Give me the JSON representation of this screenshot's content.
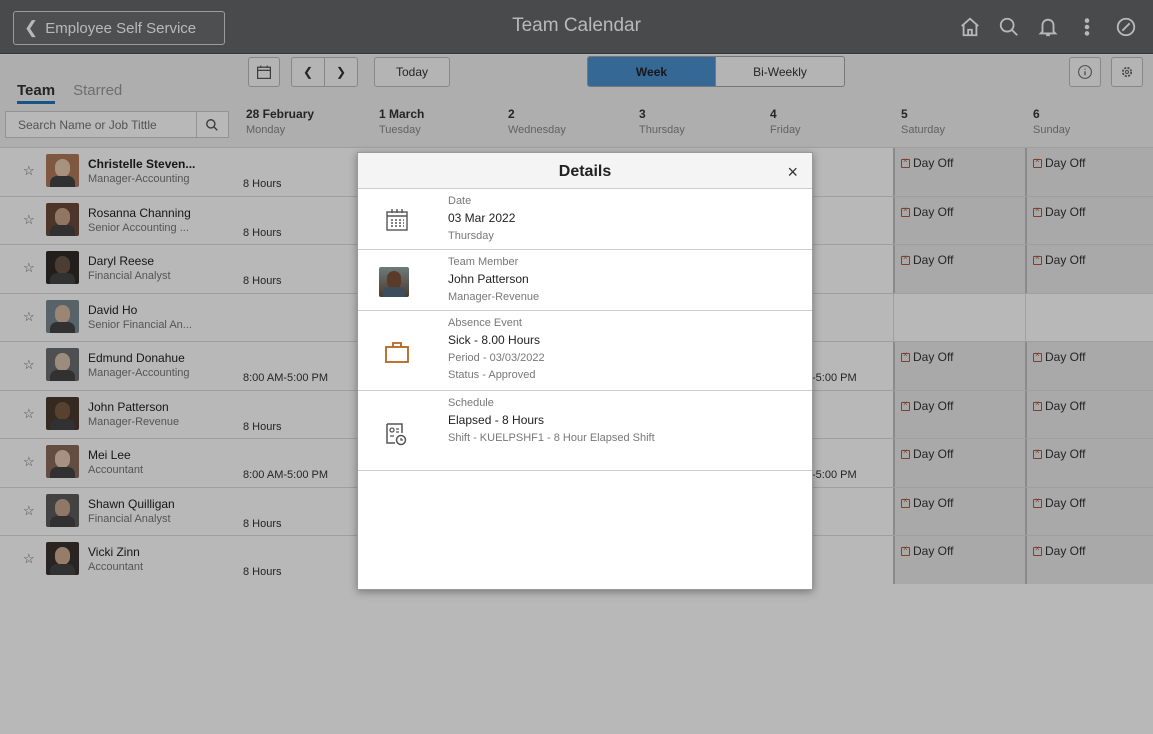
{
  "topbar": {
    "back_label": "Employee Self Service",
    "title": "Team Calendar",
    "icons": [
      "home-icon",
      "search-icon",
      "bell-icon",
      "more-icon",
      "navbar-icon"
    ]
  },
  "left_panel": {
    "tab_team": "Team",
    "tab_starred": "Starred",
    "search_placeholder": "Search Name or Job Tittle"
  },
  "toolbar": {
    "today": "Today",
    "week": "Week",
    "biweekly": "Bi-Weekly"
  },
  "days": [
    {
      "date": "28 February",
      "weekday": "Monday"
    },
    {
      "date": "1 March",
      "weekday": "Tuesday"
    },
    {
      "date": "2",
      "weekday": "Wednesday"
    },
    {
      "date": "3",
      "weekday": "Thursday"
    },
    {
      "date": "4",
      "weekday": "Friday"
    },
    {
      "date": "5",
      "weekday": "Saturday"
    },
    {
      "date": "6",
      "weekday": "Sunday"
    }
  ],
  "employees": [
    {
      "name": "Christelle Steven...",
      "job": "Manager-Accounting",
      "mon": "8 Hours",
      "fri": "",
      "sat": "Day Off",
      "sun": "Day Off"
    },
    {
      "name": "Rosanna Channing",
      "job": "Senior Accounting ...",
      "mon": "8 Hours",
      "fri": "",
      "sat": "Day Off",
      "sun": "Day Off"
    },
    {
      "name": "Daryl Reese",
      "job": "Financial Analyst",
      "mon": "8 Hours",
      "fri": "",
      "sat": "Day Off",
      "sun": "Day Off"
    },
    {
      "name": "David Ho",
      "job": "Senior Financial An...",
      "mon": "",
      "fri": "",
      "sat": "",
      "sun": ""
    },
    {
      "name": "Edmund Donahue",
      "job": "Manager-Accounting",
      "mon": "8:00 AM-5:00 PM",
      "fri": "-5:00 PM",
      "sat": "Day Off",
      "sun": "Day Off"
    },
    {
      "name": "John Patterson",
      "job": "Manager-Revenue",
      "mon": "8 Hours",
      "fri": "",
      "sat": "Day Off",
      "sun": "Day Off"
    },
    {
      "name": "Mei Lee",
      "job": "Accountant",
      "mon": "8:00 AM-5:00 PM",
      "fri": "-5:00 PM",
      "sat": "Day Off",
      "sun": "Day Off"
    },
    {
      "name": "Shawn Quilligan",
      "job": "Financial Analyst",
      "mon": "8 Hours",
      "fri": "",
      "sat": "Day Off",
      "sun": "Day Off"
    },
    {
      "name": "Vicki Zinn",
      "job": "Accountant",
      "mon": "8 Hours",
      "fri": "",
      "sat": "Day Off",
      "sun": "Day Off"
    }
  ],
  "modal": {
    "title": "Details",
    "close": "×",
    "date": {
      "label": "Date",
      "value": "03 Mar 2022",
      "sub": "Thursday"
    },
    "member": {
      "label": "Team Member",
      "value": "John Patterson",
      "sub": "Manager-Revenue"
    },
    "absence": {
      "label": "Absence Event",
      "value": "Sick - 8.00 Hours",
      "period": "Period - 03/03/2022",
      "status": "Status - Approved"
    },
    "schedule": {
      "label": "Schedule",
      "value": "Elapsed - 8 Hours",
      "shift": "Shift - KUELPSHF1 - 8 Hour Elapsed Shift"
    }
  },
  "colors": {
    "topbar": "#666769",
    "accent": "#4c90cf",
    "absence_icon": "#b5651d"
  }
}
